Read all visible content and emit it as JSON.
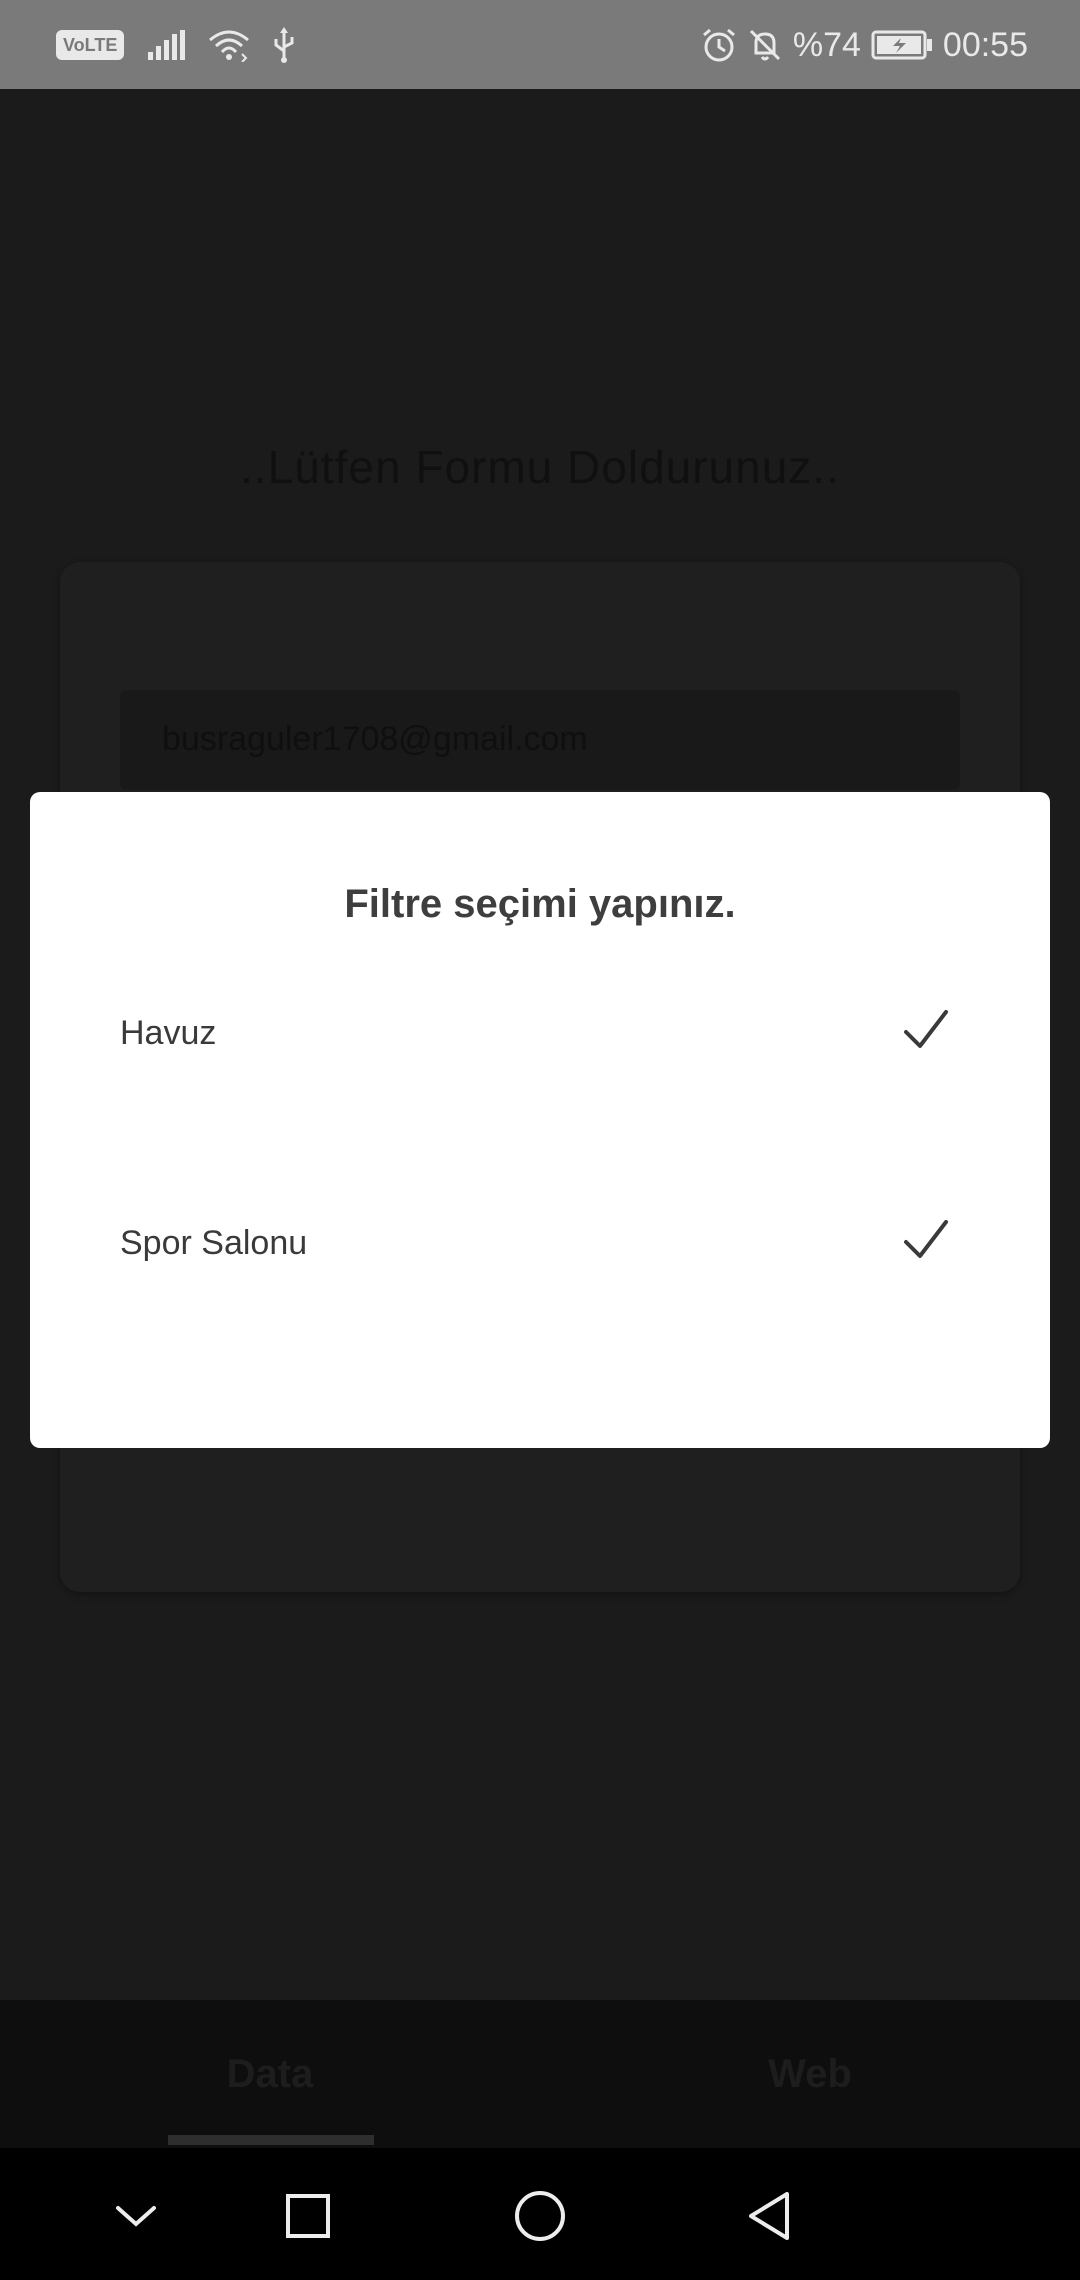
{
  "status_bar": {
    "volte": "VoLTE",
    "battery_percent": "%74",
    "time": "00:55"
  },
  "page": {
    "form_title": "..Lütfen Formu Doldurunuz..",
    "email_value": "busraguler1708@gmail.com"
  },
  "dialog": {
    "title": "Filtre seçimi yapınız.",
    "options": [
      {
        "label": "Havuz",
        "checked": true
      },
      {
        "label": "Spor Salonu",
        "checked": true
      }
    ]
  },
  "bottom_tabs": {
    "items": [
      {
        "label": "Data",
        "selected": true
      },
      {
        "label": "Web",
        "selected": false
      }
    ]
  },
  "icons": {
    "signal": "signal-icon",
    "wifi": "wifi-icon",
    "usb": "usb-icon",
    "alarm": "alarm-icon",
    "mute": "notification-off-icon",
    "battery": "battery-charging-icon",
    "check": "check-icon",
    "nav_down": "chevron-down-icon",
    "nav_recent": "square-icon",
    "nav_home": "circle-icon",
    "nav_back": "triangle-back-icon"
  },
  "colors": {
    "scrim": "#1b1b1b",
    "dialog_bg": "#ffffff",
    "dialog_text": "#3e3e3e",
    "status_bar_bg": "#7a7a7a"
  }
}
